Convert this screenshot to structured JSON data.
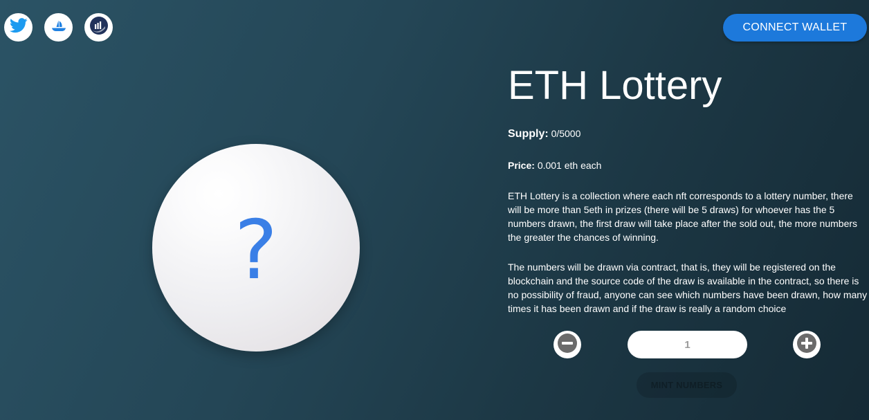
{
  "social": {
    "icons": [
      "twitter-icon",
      "opensea-icon",
      "chart-logo-icon"
    ]
  },
  "header": {
    "connect_label": "CONNECT WALLET",
    "accent_color": "#1d79db"
  },
  "ball": {
    "symbol": "?",
    "symbol_color": "#3a7fe6"
  },
  "main": {
    "title": "ETH Lottery",
    "supply_label": "Supply:",
    "supply_value": "0/5000",
    "price_label": "Price:",
    "price_value": "0.001 eth each",
    "description_1": "ETH Lottery is a collection where each nft corresponds to a lottery number, there will be more than 5eth in prizes (there will be 5 draws) for whoever has the 5 numbers drawn, the first draw will take place after the sold out, the more numbers the greater the chances of winning.",
    "description_2": "The numbers will be drawn via contract, that is, they will be registered on the blockchain and the source code of the draw is available in the contract, so there is no possibility of fraud, anyone can see which numbers have been drawn, how many times it has been drawn and if the draw is really a random choice"
  },
  "mint": {
    "quantity_value": "1",
    "minus_icon": "minus-icon",
    "plus_icon": "plus-icon",
    "mint_label": "MINT NUMBERS"
  }
}
